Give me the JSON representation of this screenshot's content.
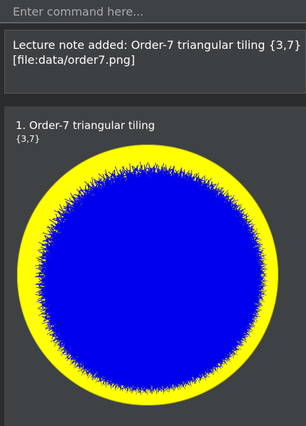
{
  "command": {
    "value": "",
    "placeholder": "Enter command here..."
  },
  "result": {
    "message": "Lecture note added: Order-7 triangular tiling {3,7}\n[file:data/order7.png]"
  },
  "notes": [
    {
      "index": "1.",
      "title": "Order-7 triangular tiling",
      "tags": "{3,7}",
      "image": {
        "name": "order-7-triangular-tiling-image",
        "fill_color": "#ffff00",
        "line_color": "#0000ee"
      }
    }
  ],
  "colors": {
    "background": "#2b2c2e",
    "panel": "#3f4244",
    "text": "#ffffff"
  }
}
